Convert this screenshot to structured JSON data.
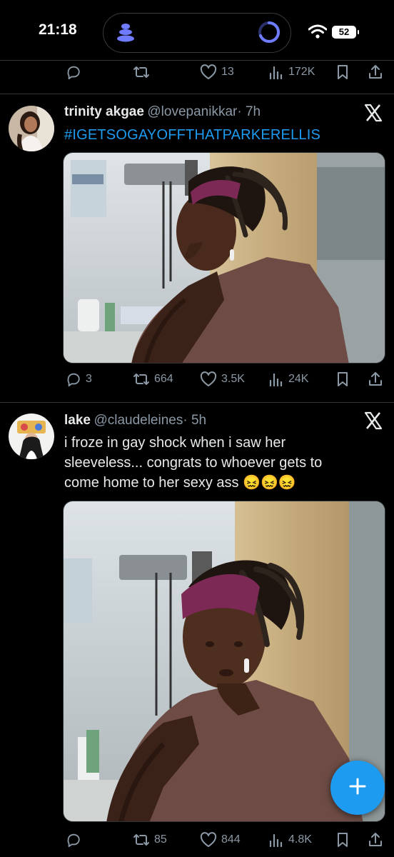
{
  "status_bar": {
    "time": "21:18",
    "battery": "52"
  },
  "top_actions": {
    "likes": "13",
    "views": "172K"
  },
  "tweets": [
    {
      "display_name": "trinity akgae",
      "handle": "@lovepanikkar",
      "age": "· 7h",
      "text": "#IGETSOGAYOFFTHATPARKERELLIS",
      "actions": {
        "replies": "3",
        "reposts": "664",
        "likes": "3.5K",
        "views": "24K"
      }
    },
    {
      "display_name": "lake",
      "handle": "@claudeleines",
      "age": "· 5h",
      "text_lines": [
        "i froze in gay shock when i saw her",
        "sleeveless... congrats to whoever gets to",
        "come home to her sexy ass 😖😖😖"
      ],
      "actions": {
        "replies": "",
        "reposts": "85",
        "likes": "844",
        "views": "4.8K"
      }
    }
  ],
  "colors": {
    "accent": "#1d9bf0",
    "muted": "#8b98a5",
    "text": "#e7e9ea",
    "divider": "#2f3336"
  },
  "icons": [
    "reply-icon",
    "repost-icon",
    "like-icon",
    "views-icon",
    "bookmark-icon",
    "share-icon",
    "x-logo-icon",
    "compose-plus-icon"
  ]
}
